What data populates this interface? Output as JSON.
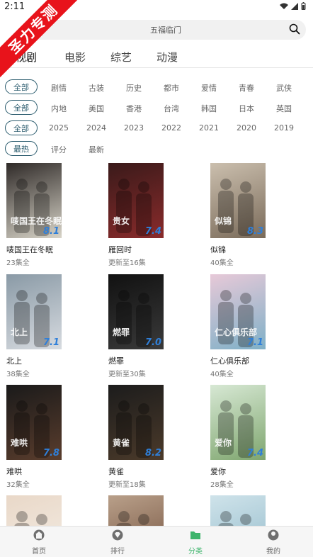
{
  "status": {
    "time": "2:11"
  },
  "watermark": "圣力专测",
  "search": {
    "text": "五福临门"
  },
  "categories": [
    "视剧",
    "电影",
    "综艺",
    "动漫"
  ],
  "filters": {
    "row1": {
      "selected": "全部",
      "options": [
        "剧情",
        "古装",
        "历史",
        "都市",
        "爱情",
        "青春",
        "武侠"
      ]
    },
    "row2": {
      "selected": "全部",
      "options": [
        "内地",
        "美国",
        "香港",
        "台湾",
        "韩国",
        "日本",
        "英国"
      ]
    },
    "row3": {
      "selected": "全部",
      "options": [
        "2025",
        "2024",
        "2023",
        "2022",
        "2021",
        "2020",
        "2019"
      ]
    },
    "row4": {
      "selected": "最热",
      "options": [
        "评分",
        "最新"
      ]
    }
  },
  "items": [
    {
      "title": "唛国王在冬眠",
      "sub": "23集全",
      "score": "8.1",
      "poster_text": "唛国王在冬眠",
      "c1": "#2f2a28",
      "c2": "#d8d4c8"
    },
    {
      "title": "雁回时",
      "sub": "更新至16集",
      "score": "7.4",
      "poster_text": "贵女",
      "c1": "#3a1a1a",
      "c2": "#8a2b2b"
    },
    {
      "title": "似锦",
      "sub": "40集全",
      "score": "8.3",
      "poster_text": "似锦",
      "c1": "#cbbfae",
      "c2": "#7a6b5a"
    },
    {
      "title": "北上",
      "sub": "38集全",
      "score": "7.1",
      "poster_text": "北上",
      "c1": "#8a9aa6",
      "c2": "#d7dbe0"
    },
    {
      "title": "燃罪",
      "sub": "更新至30集",
      "score": "7.0",
      "poster_text": "燃罪",
      "c1": "#111111",
      "c2": "#3a3a3a"
    },
    {
      "title": "仁心俱乐部",
      "sub": "40集全",
      "score": "7.1",
      "poster_text": "仁心俱乐部",
      "c1": "#e7c9d8",
      "c2": "#7fb0c7"
    },
    {
      "title": "难哄",
      "sub": "32集全",
      "score": "7.8",
      "poster_text": "难哄",
      "c1": "#1a1a1a",
      "c2": "#5a3d2d"
    },
    {
      "title": "黄雀",
      "sub": "更新至18集",
      "score": "8.2",
      "poster_text": "黄雀",
      "c1": "#1c1c1c",
      "c2": "#4b3a2a"
    },
    {
      "title": "爱你",
      "sub": "28集全",
      "score": "7.4",
      "poster_text": "爱你",
      "c1": "#d7e8d4",
      "c2": "#7fa66f"
    },
    {
      "title": "",
      "sub": "",
      "score": "",
      "poster_text": "",
      "c1": "#e9d8c8",
      "c2": "#f4eee6"
    },
    {
      "title": "",
      "sub": "",
      "score": "",
      "poster_text": "",
      "c1": "#b9a08a",
      "c2": "#6f4d3a"
    },
    {
      "title": "",
      "sub": "",
      "score": "",
      "poster_text": "",
      "c1": "#cfe3ea",
      "c2": "#8fb8c9"
    }
  ],
  "bottom_nav": [
    {
      "label": "首页",
      "icon": "home-icon"
    },
    {
      "label": "排行",
      "icon": "rank-icon"
    },
    {
      "label": "分类",
      "icon": "folder-icon"
    },
    {
      "label": "我的",
      "icon": "profile-icon"
    }
  ],
  "colors": {
    "accent_green": "#3db46b",
    "chip_border": "#2a5b6d",
    "ribbon_red": "#e8131b",
    "score_blue": "#2f7fd9"
  }
}
